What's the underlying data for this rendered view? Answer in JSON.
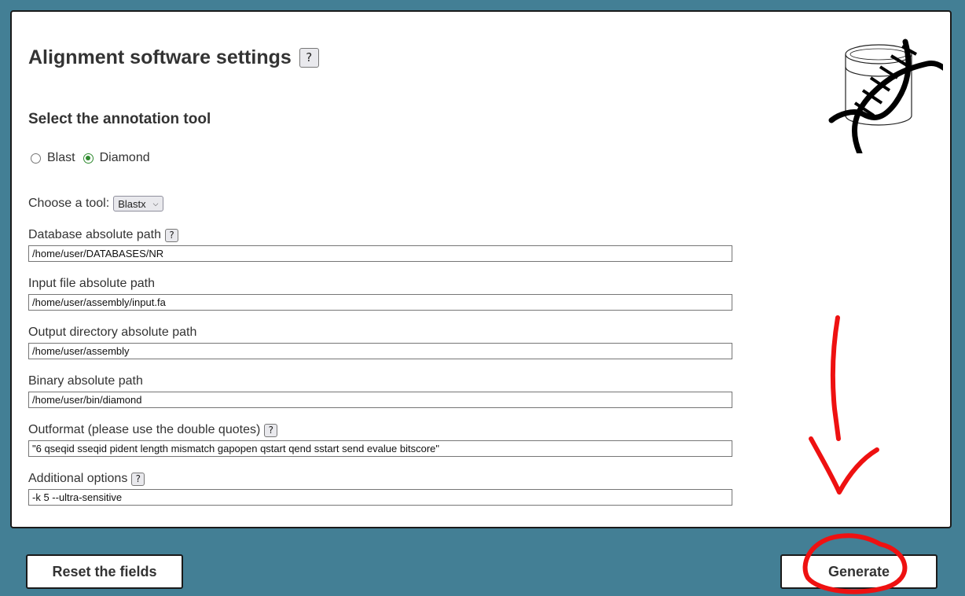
{
  "settings": {
    "title": "Alignment software settings",
    "help_symbol": "?",
    "subtitle": "Select the annotation tool",
    "radio_options": [
      {
        "label": "Blast",
        "checked": false
      },
      {
        "label": "Diamond",
        "checked": true
      }
    ],
    "choose_tool_label": "Choose a tool:",
    "tool_selected": "Blastx",
    "fields": [
      {
        "label": "Database absolute path",
        "value": "/home/user/DATABASES/NR"
      },
      {
        "label": "Input file absolute path",
        "value": "/home/user/assembly/input.fa"
      },
      {
        "label": "Output directory absolute path",
        "value": "/home/user/assembly"
      },
      {
        "label": "Binary absolute path",
        "value": "/home/user/bin/diamond"
      },
      {
        "label": "Outformat (please use the double quotes)",
        "value": "\"6 qseqid sseqid pident length mismatch gapopen qstart qend sstart send evalue bitscore\""
      },
      {
        "label": "Additional options",
        "value": "-k 5 --ultra-sensitive"
      }
    ]
  },
  "actions": {
    "reset_label": "Reset the fields",
    "generate_label": "Generate"
  },
  "colors": {
    "background": "#437f95",
    "annotation": "#ee1111",
    "radio_checked": "#2f8a2f"
  },
  "icons": {
    "logo": "dna-database-icon"
  }
}
